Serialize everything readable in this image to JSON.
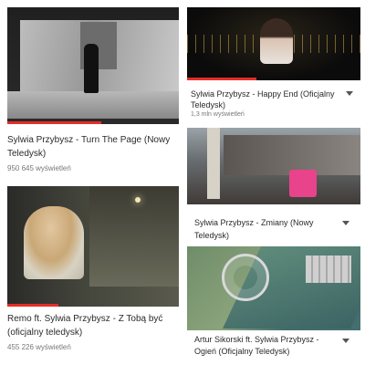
{
  "videos": [
    {
      "title": "Sylwia Przybysz - Turn The Page (Nowy Teledysk)",
      "views": "950 645 wyświetleń",
      "progress": 0.55
    },
    {
      "title": "Sylwia Przybysz - Happy End (Oficjalny Teledysk)",
      "views": "1,3 mln wyświetleń",
      "progress": 0.4
    },
    {
      "title": "Sylwia Przybysz - Zmiany (Nowy Teledysk)",
      "views": "",
      "progress": 0
    },
    {
      "title": "Remo ft. Sylwia Przybysz - Z Tobą być (oficjalny teledysk)",
      "views": "455 226 wyświetleń",
      "progress": 0.3
    },
    {
      "title": "Artur Sikorski ft. Sylwia Przybysz - Ogień (Oficjalny Teledysk)",
      "views": "",
      "progress": 0
    }
  ],
  "icons": {
    "menu": "overflow-menu-icon"
  },
  "colors": {
    "progress": "#e52d27"
  }
}
